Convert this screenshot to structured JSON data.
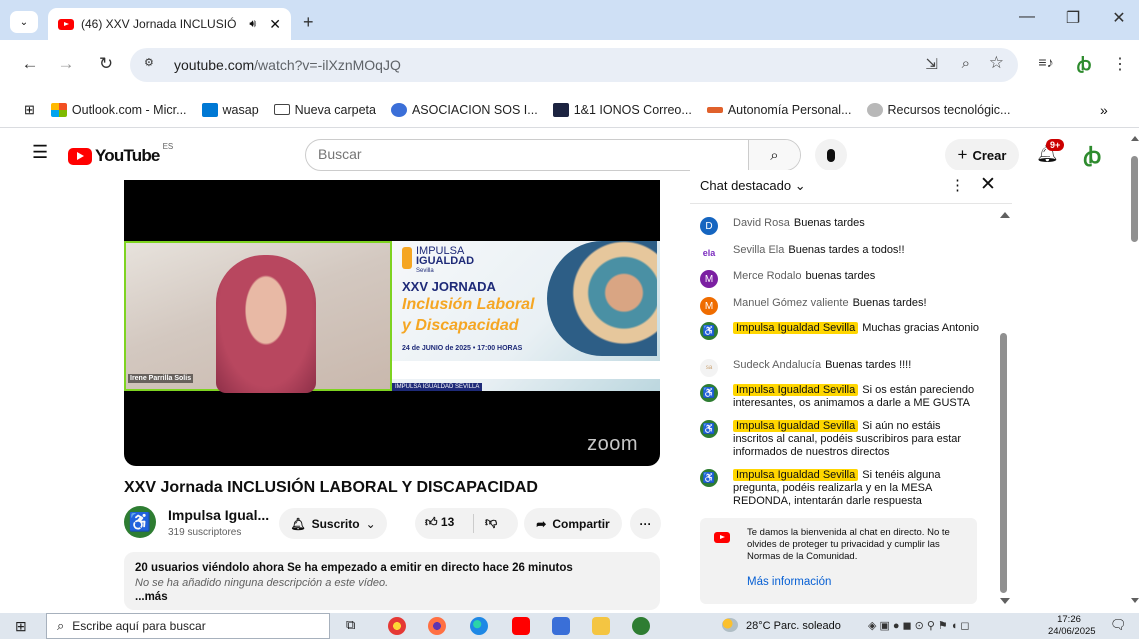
{
  "browser": {
    "tab_title": "(46) XXV Jornada INCLUSIÓ",
    "new_tab": "+",
    "url_host": "youtube.com",
    "url_path": "/watch?v=-ilXznMOqJQ",
    "bookmarks": [
      {
        "label": "Outlook.com - Micr...",
        "icon": "outlook-icon",
        "color": "#f25022"
      },
      {
        "label": "wasap",
        "icon": "wasap-icon",
        "color": "#0078d4"
      },
      {
        "label": "Nueva carpeta",
        "icon": "folder-icon",
        "color": "#ffffff"
      },
      {
        "label": "ASOCIACION SOS I...",
        "icon": "gear-icon",
        "color": "#3b6fd8"
      },
      {
        "label": "1&1 IONOS Correo...",
        "icon": "ionos-icon",
        "color": "#1c2340"
      },
      {
        "label": "Autonomía Personal...",
        "icon": "nbt-icon",
        "color": "#e0612b"
      },
      {
        "label": "Recursos tecnológic...",
        "icon": "a11y-icon",
        "color": "#8a8a8a"
      }
    ],
    "more_bookmarks": "»"
  },
  "youtube": {
    "logo_text": "YouTube",
    "logo_region": "ES",
    "search_placeholder": "Buscar",
    "create_label": "Crear",
    "notifications_badge": "9+",
    "accent": "#ff0000"
  },
  "video": {
    "title": "XXV Jornada INCLUSIÓN LABORAL Y DISCAPACIDAD",
    "speaker_name": "Irene Parrilla Solis",
    "slide": {
      "brand_top": "IMPULSA",
      "brand_bottom": "IGUALDAD",
      "brand_city": "Sevilla",
      "line1": "XXV JORNADA",
      "line2": "Inclusión Laboral",
      "line3": "y Discapacidad",
      "date": "24 de JUNIO de 2025 • 17:00 HORAS",
      "footer": "IMPULSA IGUALDAD SEVILLA"
    },
    "watermark": "zoom"
  },
  "channel": {
    "name": "Impulsa Igual...",
    "subscribers": "319 suscriptores",
    "subscribed_label": "Suscrito",
    "likes": "13",
    "share_label": "Compartir",
    "more": "···"
  },
  "description": {
    "stats": "20 usuarios viéndolo ahora  Se ha empezado a emitir en directo hace 26 minutos",
    "body": "No se ha añadido ninguna descripción a este vídeo.",
    "more": "...más"
  },
  "chat": {
    "header": "Chat destacado",
    "messages": [
      {
        "author": "David Rosa",
        "text": "Buenas tardes",
        "avatar": "D",
        "color": "#1565c0",
        "highlight": false
      },
      {
        "author": "Sevilla Ela",
        "text": "Buenas tardes a todos!!",
        "avatar": "ela",
        "color": "#7b2cbf",
        "highlight": false
      },
      {
        "author": "Merce Rodalo",
        "text": "buenas tardes",
        "avatar": "M",
        "color": "#7b1fa2",
        "highlight": false
      },
      {
        "author": "Manuel Gómez valiente",
        "text": "Buenas tardes!",
        "avatar": "M",
        "color": "#ef6c00",
        "highlight": false
      },
      {
        "author": "Impulsa Igualdad Sevilla",
        "text": "Muchas gracias Antonio",
        "avatar": "♿",
        "color": "#2e7d32",
        "highlight": true
      },
      {
        "author": "Sudeck Andalucía",
        "text": "Buenas tardes !!!!",
        "avatar": "sa",
        "color": "#f3f3f3",
        "highlight": false
      },
      {
        "author": "Impulsa Igualdad Sevilla",
        "text": "Si os están pareciendo interesantes, os animamos a darle a ME GUSTA",
        "avatar": "♿",
        "color": "#2e7d32",
        "highlight": true
      },
      {
        "author": "Impulsa Igualdad Sevilla",
        "text": "Si aún no estáis inscritos al canal, podéis suscribiros para estar informados de nuestros directos",
        "avatar": "♿",
        "color": "#2e7d32",
        "highlight": true
      },
      {
        "author": "Impulsa Igualdad Sevilla",
        "text": "Si tenéis alguna pregunta, podéis realizarla y en la MESA REDONDA, intentarán darle respuesta",
        "avatar": "♿",
        "color": "#2e7d32",
        "highlight": true
      }
    ],
    "welcome": "Te damos la bienvenida al chat en directo. No te olvides de proteger tu privacidad y cumplir las Normas de la Comunidad.",
    "more_info": "Más información"
  },
  "taskbar": {
    "search_placeholder": "Escribe aquí para buscar",
    "weather": "28°C  Parc. soleado",
    "time": "17:26",
    "date": "24/06/2025"
  }
}
